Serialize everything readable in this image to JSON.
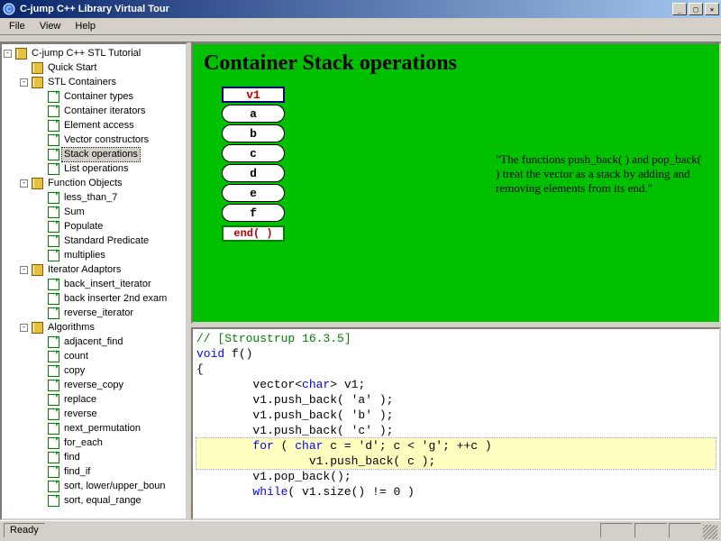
{
  "window": {
    "title": "C-jump C++ Library Virtual Tour"
  },
  "menus": [
    "File",
    "View",
    "Help"
  ],
  "tree": [
    {
      "d": 0,
      "exp": "-",
      "ico": "book",
      "lbl": "C-jump C++ STL Tutorial"
    },
    {
      "d": 1,
      "exp": "",
      "ico": "book",
      "lbl": "Quick Start"
    },
    {
      "d": 1,
      "exp": "-",
      "ico": "book",
      "lbl": "STL Containers"
    },
    {
      "d": 2,
      "exp": "",
      "ico": "page",
      "lbl": "Container types"
    },
    {
      "d": 2,
      "exp": "",
      "ico": "page",
      "lbl": "Container iterators"
    },
    {
      "d": 2,
      "exp": "",
      "ico": "page",
      "lbl": "Element access"
    },
    {
      "d": 2,
      "exp": "",
      "ico": "page",
      "lbl": "Vector constructors"
    },
    {
      "d": 2,
      "exp": "",
      "ico": "page",
      "lbl": "Stack operations",
      "sel": true
    },
    {
      "d": 2,
      "exp": "",
      "ico": "page",
      "lbl": "List operations"
    },
    {
      "d": 1,
      "exp": "-",
      "ico": "book",
      "lbl": "Function Objects"
    },
    {
      "d": 2,
      "exp": "",
      "ico": "page",
      "lbl": "less_than_7"
    },
    {
      "d": 2,
      "exp": "",
      "ico": "page",
      "lbl": "Sum"
    },
    {
      "d": 2,
      "exp": "",
      "ico": "page",
      "lbl": "Populate"
    },
    {
      "d": 2,
      "exp": "",
      "ico": "page",
      "lbl": "Standard Predicate"
    },
    {
      "d": 2,
      "exp": "",
      "ico": "page",
      "lbl": "multiplies"
    },
    {
      "d": 1,
      "exp": "-",
      "ico": "book",
      "lbl": "Iterator Adaptors"
    },
    {
      "d": 2,
      "exp": "",
      "ico": "page",
      "lbl": "back_insert_iterator"
    },
    {
      "d": 2,
      "exp": "",
      "ico": "page",
      "lbl": "back inserter 2nd exam"
    },
    {
      "d": 2,
      "exp": "",
      "ico": "page",
      "lbl": "reverse_iterator"
    },
    {
      "d": 1,
      "exp": "-",
      "ico": "book",
      "lbl": "Algorithms"
    },
    {
      "d": 2,
      "exp": "",
      "ico": "page",
      "lbl": "adjacent_find"
    },
    {
      "d": 2,
      "exp": "",
      "ico": "page",
      "lbl": "count"
    },
    {
      "d": 2,
      "exp": "",
      "ico": "page",
      "lbl": "copy"
    },
    {
      "d": 2,
      "exp": "",
      "ico": "page",
      "lbl": "reverse_copy"
    },
    {
      "d": 2,
      "exp": "",
      "ico": "page",
      "lbl": "replace"
    },
    {
      "d": 2,
      "exp": "",
      "ico": "page",
      "lbl": "reverse"
    },
    {
      "d": 2,
      "exp": "",
      "ico": "page",
      "lbl": "next_permutation"
    },
    {
      "d": 2,
      "exp": "",
      "ico": "page",
      "lbl": "for_each"
    },
    {
      "d": 2,
      "exp": "",
      "ico": "page",
      "lbl": "find"
    },
    {
      "d": 2,
      "exp": "",
      "ico": "page",
      "lbl": "find_if"
    },
    {
      "d": 2,
      "exp": "",
      "ico": "page",
      "lbl": "sort, lower/upper_boun"
    },
    {
      "d": 2,
      "exp": "",
      "ico": "page",
      "lbl": "sort, equal_range"
    }
  ],
  "vis": {
    "title": "Container Stack operations",
    "head": "v1",
    "cells": [
      "a",
      "b",
      "c",
      "d",
      "e",
      "f"
    ],
    "end": "end( )",
    "quote": "\"The functions push_back( ) and pop_back( ) treat the vector as a stack by adding and removing elements from its end.\""
  },
  "code": {
    "l1": "// [Stroustrup 16.3.5]",
    "l2a": "void",
    "l2b": " f()",
    "l3": "{",
    "l4a": "        vector",
    "l4b": "<",
    "l4c": "char",
    "l4d": "> v1;",
    "l5": "        v1.push_back( 'a' );",
    "l6": "        v1.push_back( 'b' );",
    "l7": "        v1.push_back( 'c' );",
    "l8a": "        for",
    "l8b": " ( ",
    "l8c": "char",
    "l8d": " c = 'd'; c < 'g'; ++c )",
    "l9": "                v1.push_back( c );",
    "l10": "        v1.pop_back();",
    "l11a": "        while",
    "l11b": "( v1.size() != 0 )"
  },
  "status": {
    "text": "Ready"
  }
}
